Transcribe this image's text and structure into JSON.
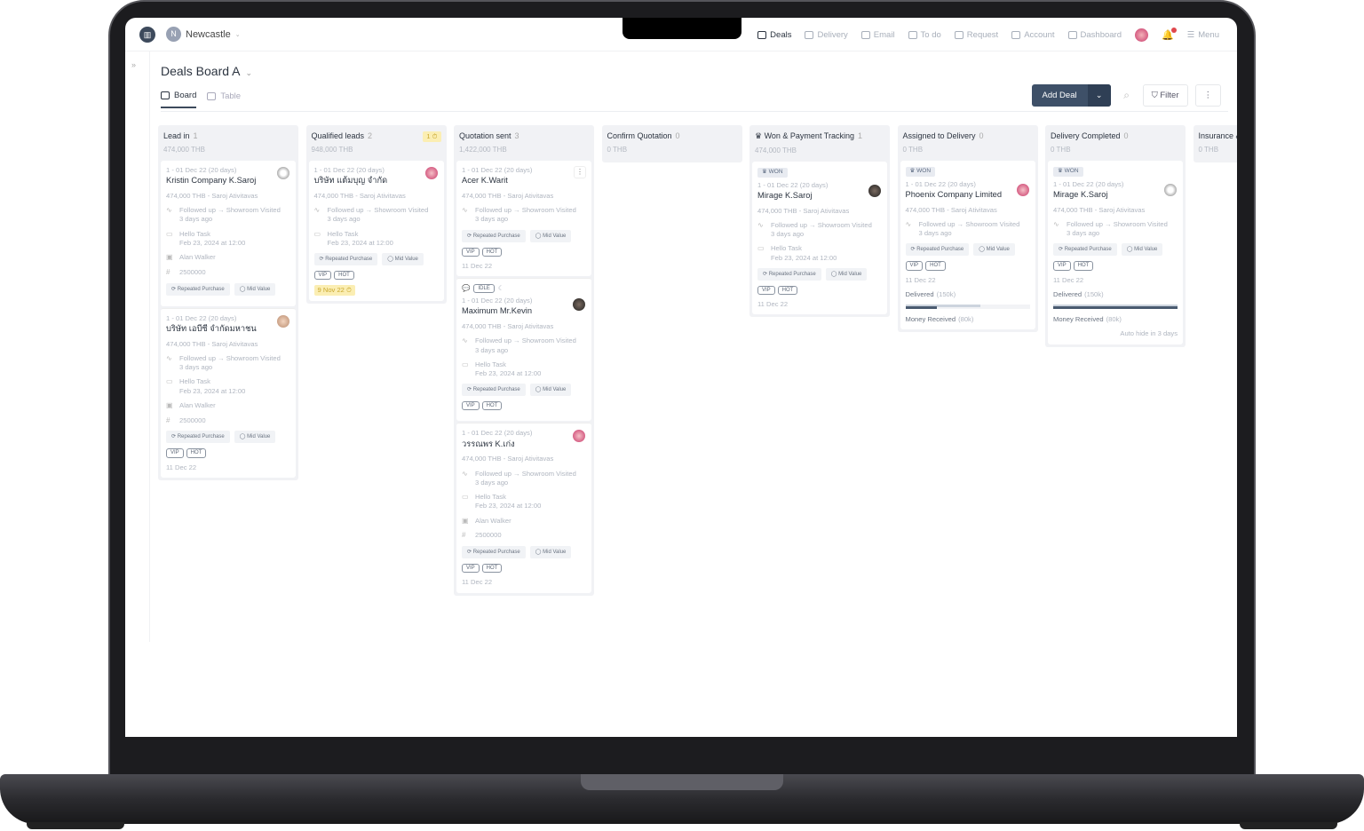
{
  "workspace": {
    "initial": "N",
    "name": "Newcastle"
  },
  "nav": [
    {
      "label": "Deals",
      "active": true
    },
    {
      "label": "Delivery"
    },
    {
      "label": "Email"
    },
    {
      "label": "To do"
    },
    {
      "label": "Request"
    },
    {
      "label": "Account"
    },
    {
      "label": "Dashboard"
    }
  ],
  "menu_label": "Menu",
  "page": {
    "title": "Deals Board A",
    "tabs": [
      {
        "label": "Board"
      },
      {
        "label": "Table"
      }
    ]
  },
  "actions": {
    "add_deal": "Add Deal",
    "filter": "Filter"
  },
  "colors": {
    "accent": "#3e5068",
    "warning": "#fbeeb3",
    "text": "#2c3440"
  },
  "columns": [
    {
      "name": "Lead in",
      "count": "1",
      "amount": "474,000 THB",
      "cards": [
        {
          "meta": "1 - 01 Dec 22 (20 days)",
          "title": "Kristin Company K.Saroj",
          "avatar": "gray",
          "amount": "474,000 THB  - Saroj Ativitavas",
          "activity": "Followed up → Showroom Visited",
          "ago": "3 days ago",
          "task": "Hello Task",
          "task_date": "Feb 23, 2024 at 12:00",
          "contact": "Alan Walker",
          "number": "2500000",
          "tags": [
            "Repeated Purchase",
            "Mid Value"
          ]
        },
        {
          "meta": "1 - 01 Dec 22 (20 days)",
          "title": "บริษัท เอบีซี จำกัดมหาชน",
          "avatar": "light",
          "amount": "474,000 THB  - Saroj Ativitavas",
          "activity": "Followed up → Showroom Visited",
          "ago": "3 days ago",
          "task": "Hello Task",
          "task_date": "Feb 23, 2024 at 12:00",
          "contact": "Alan Walker",
          "number": "2500000",
          "tags": [
            "Repeated Purchase",
            "Mid Value"
          ],
          "chips": [
            "VIP",
            "HOT"
          ],
          "date": "11 Dec 22"
        }
      ]
    },
    {
      "name": "Qualified leads",
      "count": "2",
      "amount": "948,000 THB",
      "warning": "1 ⏱",
      "cards": [
        {
          "meta": "1 - 01 Dec 22 (20 days)",
          "title": "บริษัท แต้มบุญ จำกัด",
          "avatar": "pink",
          "amount": "474,000 THB  - Saroj Ativitavas",
          "activity": "Followed up → Showroom Visited",
          "ago": "3 days ago",
          "task": "Hello Task",
          "task_date": "Feb 23, 2024 at 12:00",
          "tags": [
            "Repeated Purchase",
            "Mid Value"
          ],
          "chips": [
            "VIP",
            "HOT"
          ],
          "due": "9 Nov 22 ⏱"
        }
      ]
    },
    {
      "name": "Quotation sent",
      "count": "3",
      "amount": "1,422,000 THB",
      "cards": [
        {
          "meta": "1 - 01 Dec 22 (20 days)",
          "title": "Acer K.Warit",
          "more": true,
          "amount": "474,000 THB  - Saroj Ativitavas",
          "activity": "Followed up → Showroom Visited",
          "ago": "3 days ago",
          "tags": [
            "Repeated Purchase",
            "Mid Value"
          ],
          "chips": [
            "VIP",
            "HOT"
          ],
          "date": "11 Dec 22"
        },
        {
          "idle": "IDLE",
          "meta": "1 - 01 Dec 22 (20 days)",
          "title": "Maximum Mr.Kevin",
          "avatar": "dark",
          "amount": "474,000 THB  - Saroj Ativitavas",
          "activity": "Followed up → Showroom Visited",
          "ago": "3 days ago",
          "task": "Hello Task",
          "task_date": "Feb 23, 2024 at 12:00",
          "tags": [
            "Repeated Purchase",
            "Mid Value"
          ],
          "chips": [
            "VIP",
            "HOT"
          ]
        },
        {
          "meta": "1 - 01 Dec 22 (20 days)",
          "title": "วรรณพร K.เก่ง",
          "avatar": "pink",
          "amount": "474,000 THB  - Saroj Ativitavas",
          "activity": "Followed up → Showroom Visited",
          "ago": "3 days ago",
          "task": "Hello Task",
          "task_date": "Feb 23, 2024 at 12:00",
          "contact": "Alan Walker",
          "number": "2500000",
          "tags": [
            "Repeated Purchase",
            "Mid Value"
          ],
          "chips": [
            "VIP",
            "HOT"
          ],
          "date": "11 Dec 22"
        }
      ]
    },
    {
      "name": "Confirm Quotation",
      "count": "0",
      "amount": "0 THB",
      "cards": []
    },
    {
      "name": "Won & Payment Tracking",
      "crown": true,
      "count": "1",
      "amount": "474,000 THB",
      "cards": [
        {
          "won": "WON",
          "meta": "1 - 01 Dec 22 (20 days)",
          "title": "Mirage K.Saroj",
          "avatar": "dark",
          "amount": "474,000 THB  - Saroj Ativitavas",
          "activity": "Followed up → Showroom Visited",
          "ago": "3 days ago",
          "task": "Hello Task",
          "task_date": "Feb 23, 2024 at 12:00",
          "tags": [
            "Repeated Purchase",
            "Mid Value"
          ],
          "chips": [
            "VIP",
            "HOT"
          ],
          "date": "11 Dec 22"
        }
      ]
    },
    {
      "name": "Assigned to Delivery",
      "count": "0",
      "amount": "0 THB",
      "cards": [
        {
          "won": "WON",
          "meta": "1 - 01 Dec 22 (20 days)",
          "title": "Phoenix Company Limited",
          "avatar": "pink",
          "amount": "474,000 THB  - Saroj Ativitavas",
          "activity": "Followed up → Showroom Visited",
          "ago": "3 days ago",
          "tags": [
            "Repeated Purchase",
            "Mid Value"
          ],
          "chips": [
            "VIP",
            "HOT"
          ],
          "date": "11 Dec 22",
          "delivered": "Delivered",
          "delivered_amt": "(150k)",
          "received": "Money Received",
          "received_amt": "(80k)",
          "delivered_pct": 60,
          "received_pct": 25
        }
      ]
    },
    {
      "name": "Delivery Completed",
      "count": "0",
      "amount": "0 THB",
      "cards": [
        {
          "won": "WON",
          "meta": "1 - 01 Dec 22 (20 days)",
          "title": "Mirage K.Saroj",
          "avatar": "gray",
          "amount": "474,000 THB  - Saroj Ativitavas",
          "activity": "Followed up → Showroom Visited",
          "ago": "3 days ago",
          "tags": [
            "Repeated Purchase",
            "Mid Value"
          ],
          "chips": [
            "VIP",
            "HOT"
          ],
          "date": "11 Dec 22",
          "delivered": "Delivered",
          "delivered_amt": "(150k)",
          "received": "Money Received",
          "received_amt": "(80k)",
          "delivered_pct": 100,
          "received_pct": 100,
          "autohide": "Auto hide in 3 days"
        }
      ]
    },
    {
      "name": "Insurance &",
      "count": "",
      "amount": "0 THB",
      "cards": []
    }
  ]
}
